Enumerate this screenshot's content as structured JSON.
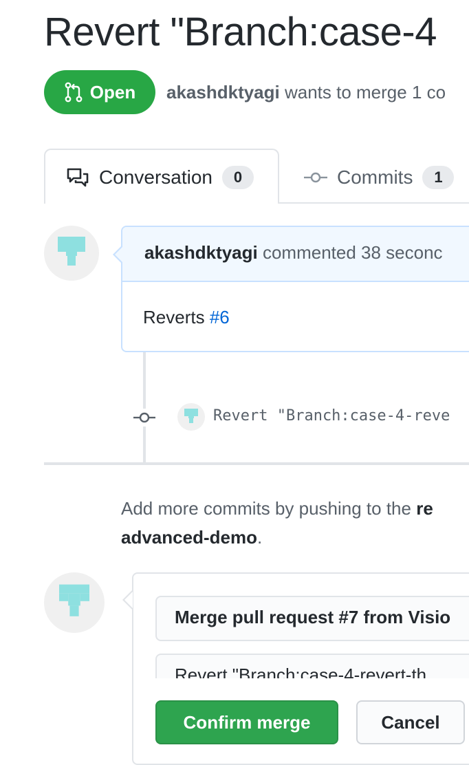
{
  "pr": {
    "title": "Revert \"Branch:case-4",
    "state": "Open",
    "author": "akashdktyagi",
    "meta_text": " wants to merge 1 co"
  },
  "tabs": [
    {
      "label": "Conversation",
      "count": "0",
      "icon": "comment-discussion-icon",
      "active": true
    },
    {
      "label": "Commits",
      "count": "1",
      "icon": "git-commit-icon",
      "active": false
    }
  ],
  "comment": {
    "author": "akashdktyagi",
    "action": " commented 38 seconc",
    "body_prefix": "Reverts ",
    "body_link": "#6"
  },
  "commit": {
    "message": "Revert \"Branch:case-4-reve"
  },
  "hint": {
    "text": "Add more commits by pushing to the ",
    "branch_part1": "re",
    "branch_part2": "advanced-demo",
    "suffix": "."
  },
  "merge": {
    "title_value": "Merge pull request #7 from Visio",
    "body_value": "Revert \"Branch:case-4-revert-th",
    "confirm_label": "Confirm merge",
    "cancel_label": "Cancel"
  },
  "colors": {
    "open_green": "#28a745",
    "link_blue": "#0366d6",
    "avatar_teal": "#8ee0e0"
  }
}
